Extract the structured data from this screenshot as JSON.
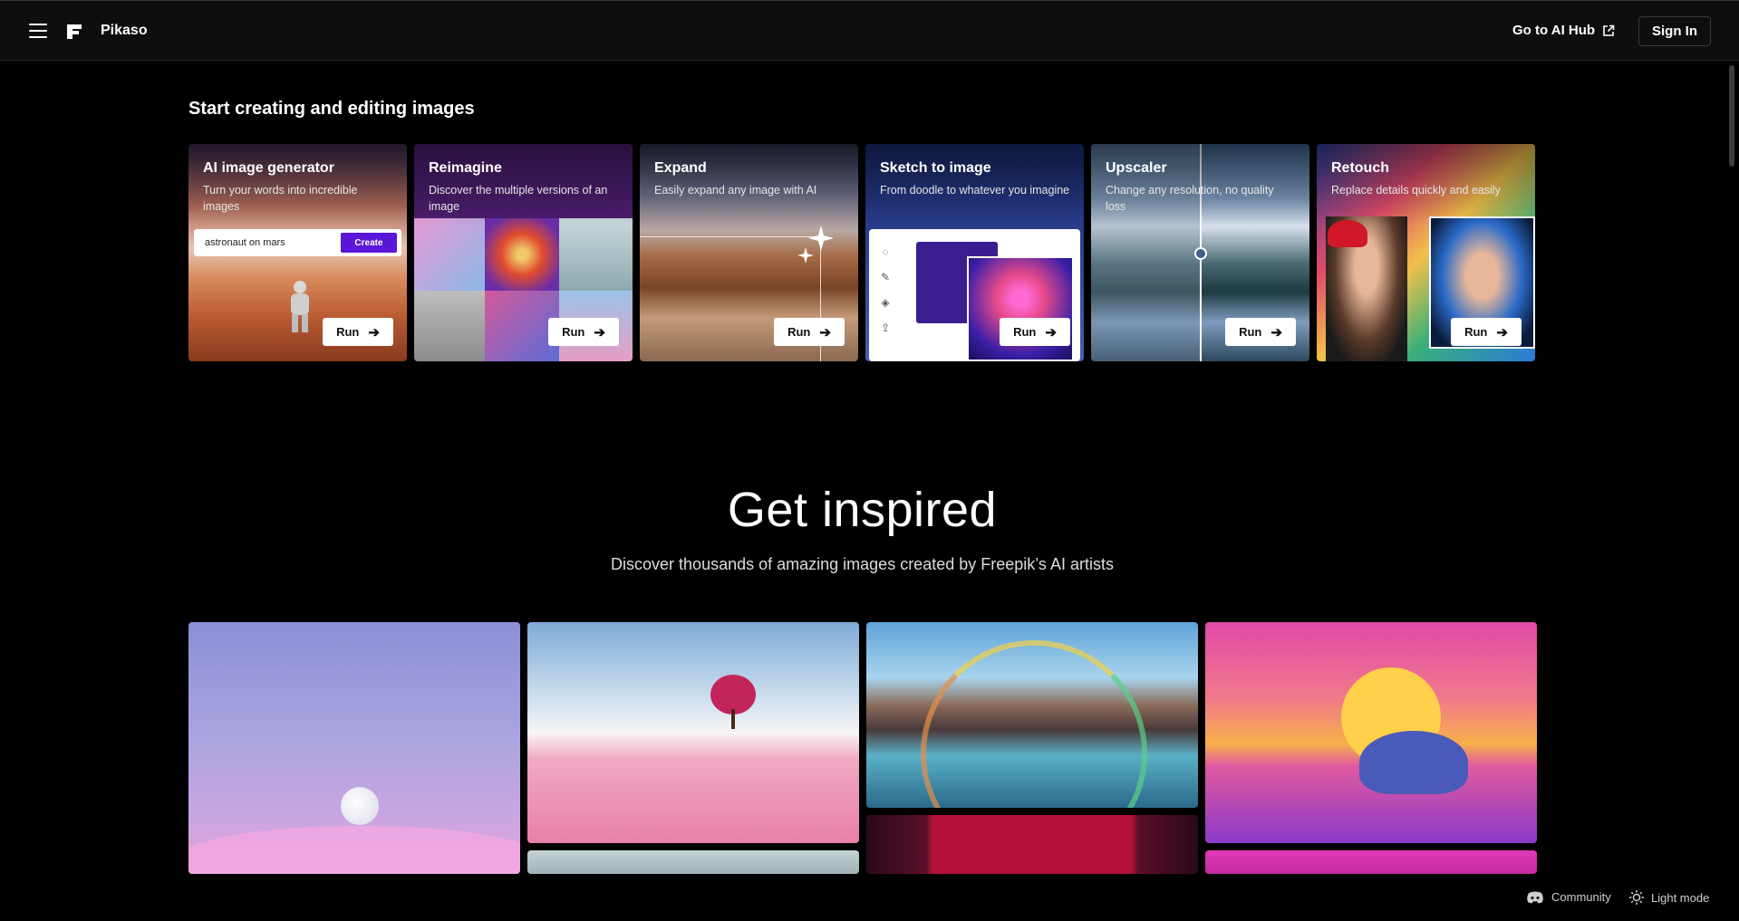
{
  "header": {
    "brand": "Pikaso",
    "hub_link": "Go to AI Hub",
    "signin": "Sign In"
  },
  "tools_section": {
    "title": "Start creating and editing images",
    "cards": [
      {
        "title": "AI image generator",
        "desc": "Turn your words into incredible images",
        "run": "Run"
      },
      {
        "title": "Reimagine",
        "desc": "Discover the multiple versions of an image",
        "run": "Run"
      },
      {
        "title": "Expand",
        "desc": "Easily expand any image with AI",
        "run": "Run"
      },
      {
        "title": "Sketch to image",
        "desc": "From doodle to whatever you imagine",
        "run": "Run"
      },
      {
        "title": "Upscaler",
        "desc": "Change any resolution, no quality loss",
        "run": "Run"
      },
      {
        "title": "Retouch",
        "desc": "Replace details quickly and easily",
        "run": "Run"
      }
    ],
    "generator_prompt": "astronaut on mars",
    "generator_button": "Create"
  },
  "inspire": {
    "title": "Get inspired",
    "subtitle": "Discover thousands of amazing images created by Freepik’s AI artists"
  },
  "footer": {
    "community": "Community",
    "light_mode": "Light mode"
  },
  "icons": {
    "menu": "hamburger-icon",
    "logo": "freepik-logo-icon",
    "external": "external-link-icon",
    "arrow": "arrow-right-icon",
    "discord": "discord-icon",
    "sun": "sun-icon"
  }
}
